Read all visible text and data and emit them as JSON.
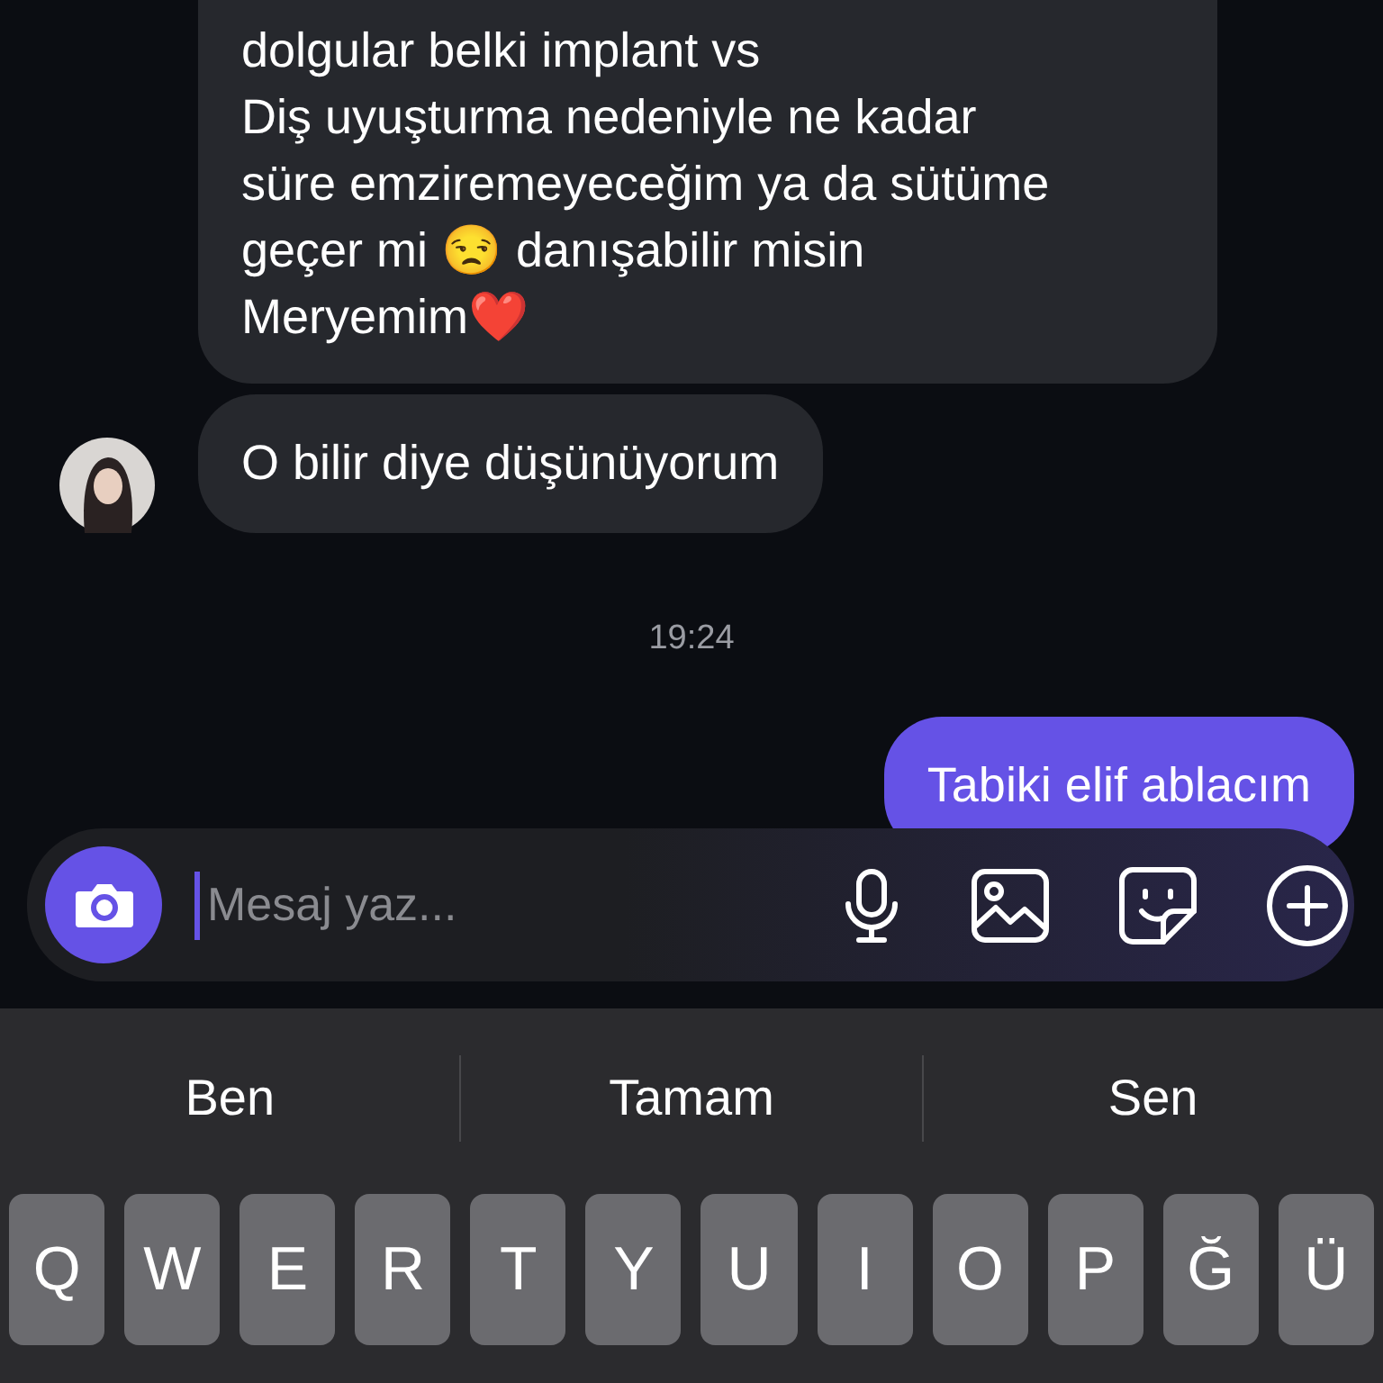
{
  "messages": [
    {
      "kind": "incoming",
      "lines": [
        "dolgular belki implant vs",
        "Diş uyuşturma nedeniyle ne kadar süre emziremeyeceğim ya da sütüme geçer mi 😒 danışabilir misin Meryemim❤️"
      ],
      "avatar": false,
      "cut_top": true
    },
    {
      "kind": "incoming",
      "lines": [
        "O bilir diye düşünüyorum"
      ],
      "avatar": true
    },
    {
      "kind": "time",
      "lines": [
        "19:24"
      ]
    },
    {
      "kind": "outgoing",
      "lines": [
        "Tabiki elif ablacım"
      ]
    }
  ],
  "composer": {
    "placeholder": "Mesaj yaz..."
  },
  "suggestions": [
    "Ben",
    "Tamam",
    "Sen"
  ],
  "keys": [
    "Q",
    "W",
    "E",
    "R",
    "T",
    "Y",
    "U",
    "I",
    "O",
    "P",
    "Ğ",
    "Ü"
  ]
}
